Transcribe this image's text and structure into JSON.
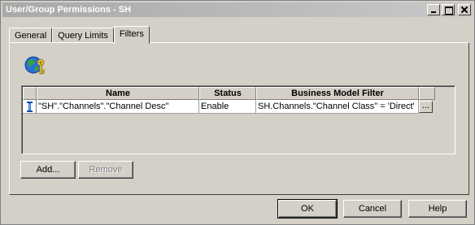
{
  "window": {
    "title": "User/Group Permissions - SH"
  },
  "tabs": [
    {
      "label": "General",
      "active": false
    },
    {
      "label": "Query Limits",
      "active": false
    },
    {
      "label": "Filters",
      "active": true
    }
  ],
  "grid": {
    "columns": [
      "Name",
      "Status",
      "Business Model Filter"
    ],
    "rows": [
      {
        "name": "\"SH\".\"Channels\".\"Channel Desc\"",
        "status": "Enable",
        "filter": "SH.Channels.\"Channel Class\" = 'Direct'",
        "edit_label": "..."
      }
    ]
  },
  "panel_buttons": {
    "add_label": "Add...",
    "remove_label": "Remove"
  },
  "dialog_buttons": {
    "ok_label": "OK",
    "cancel_label": "Cancel",
    "help_label": "Help"
  },
  "icons": {
    "header_icon": "globe-key-icon",
    "row_icon": "filter-row-icon"
  }
}
